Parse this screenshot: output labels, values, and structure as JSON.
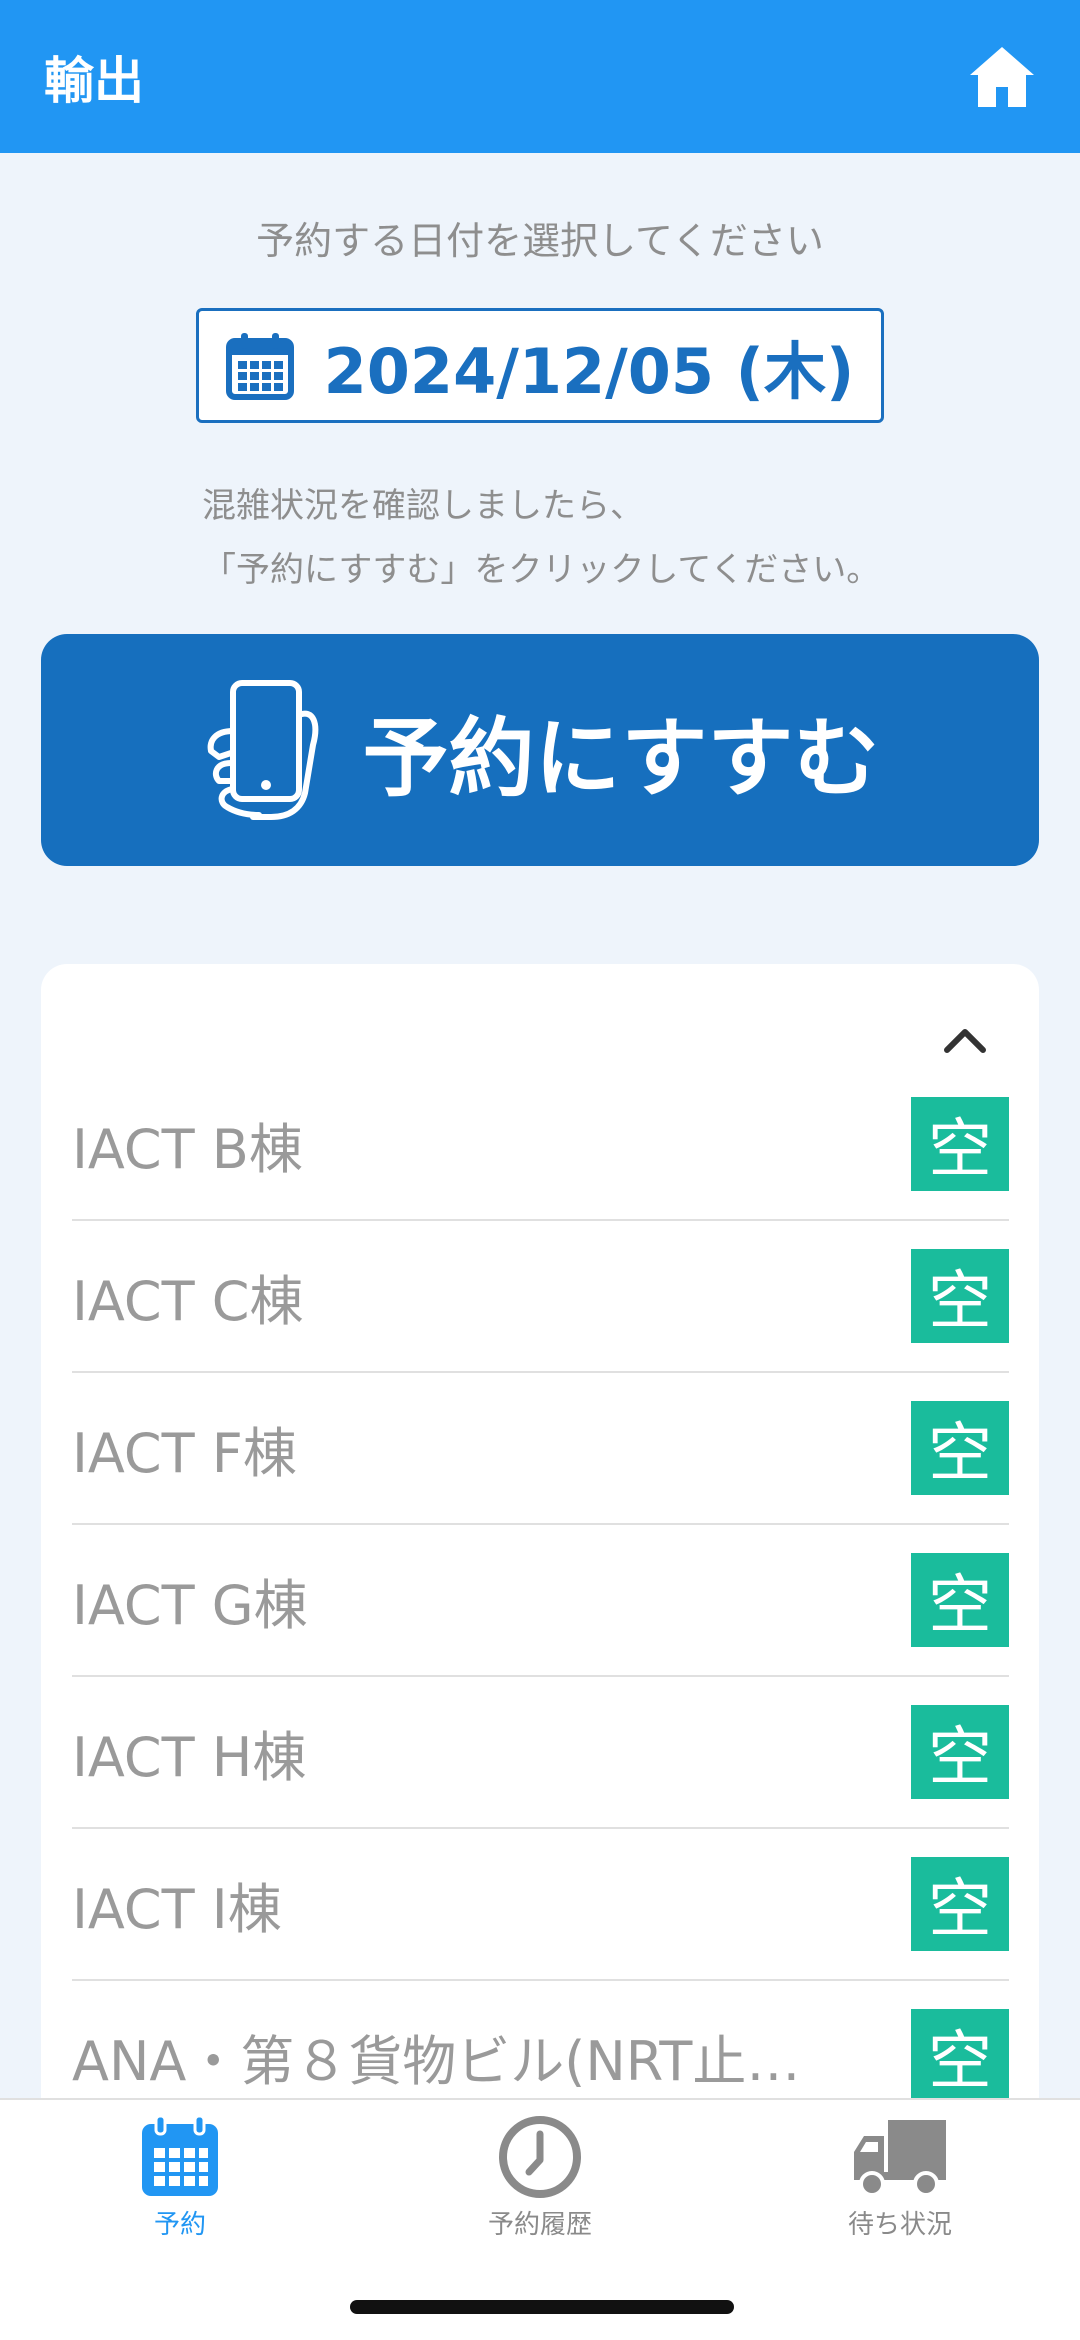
{
  "header": {
    "title": "輸出",
    "home_icon": "home-icon"
  },
  "date_prompt": "予約する日付を選択してください",
  "selected_date": "2024/12/05 (木)",
  "instructions": [
    "混雑状況を確認しましたら、",
    "「予約にすすむ」をクリックしてください。"
  ],
  "proceed_button": {
    "label": "予約にすすむ",
    "icon": "phone-in-hand-icon"
  },
  "warehouses": [
    {
      "name": "IACT B棟",
      "status": "空"
    },
    {
      "name": "IACT C棟",
      "status": "空"
    },
    {
      "name": "IACT F棟",
      "status": "空"
    },
    {
      "name": "IACT G棟",
      "status": "空"
    },
    {
      "name": "IACT H棟",
      "status": "空"
    },
    {
      "name": "IACT I棟",
      "status": "空"
    },
    {
      "name": "ANA・第８貨物ビル(NRT止…",
      "status": "空"
    }
  ],
  "tabs": [
    {
      "label": "予約",
      "icon": "calendar-icon",
      "active": true
    },
    {
      "label": "予約履歴",
      "icon": "clock-icon",
      "active": false
    },
    {
      "label": "待ち状況",
      "icon": "truck-icon",
      "active": false
    }
  ],
  "colors": {
    "header": "#2196f3",
    "primary": "#166fbe",
    "status_available": "#1abc9c",
    "tab_active": "#2196f3",
    "tab_inactive": "#8a8a8a"
  }
}
